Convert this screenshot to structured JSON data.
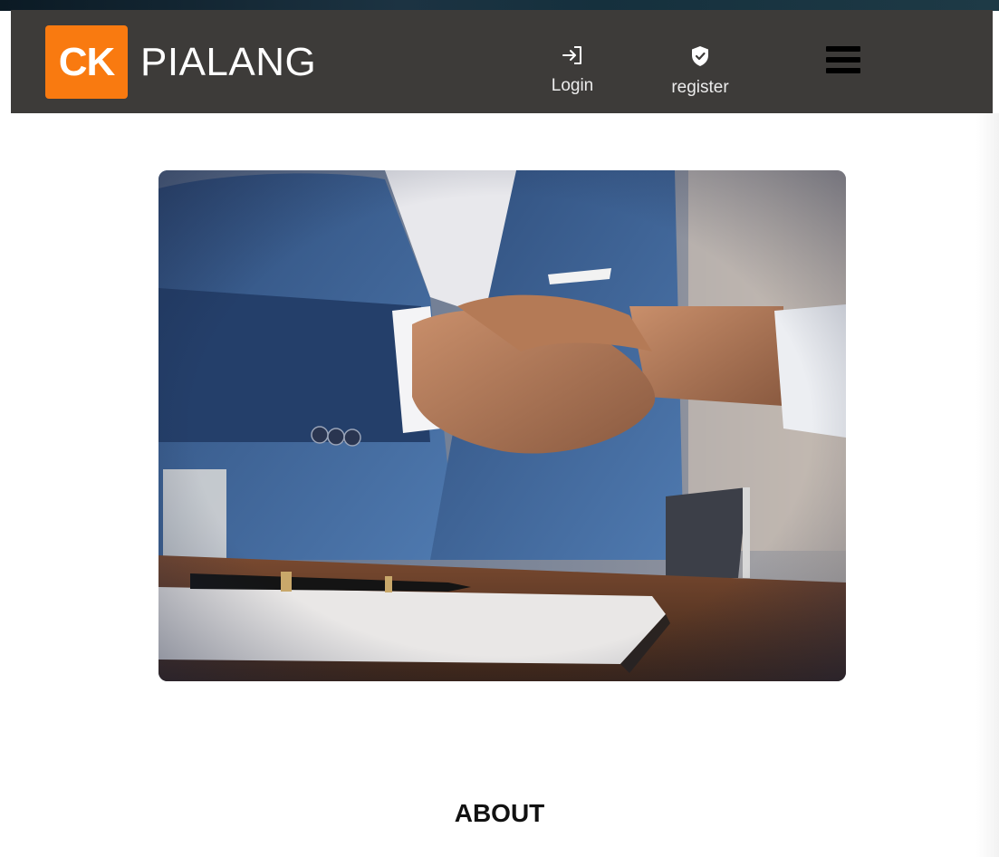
{
  "brand": {
    "logo_mark": "CK",
    "name": "PIALANG",
    "accent_color": "#f97a10",
    "navbar_color": "#3d3b39"
  },
  "nav": {
    "login": {
      "label": "Login",
      "icon": "login-icon"
    },
    "register": {
      "label": "register",
      "icon": "shield-check-icon"
    },
    "menu": {
      "icon": "hamburger-menu-icon"
    }
  },
  "hero": {
    "subject": "handshake-photo"
  },
  "sections": {
    "about_title": "ABOUT"
  }
}
